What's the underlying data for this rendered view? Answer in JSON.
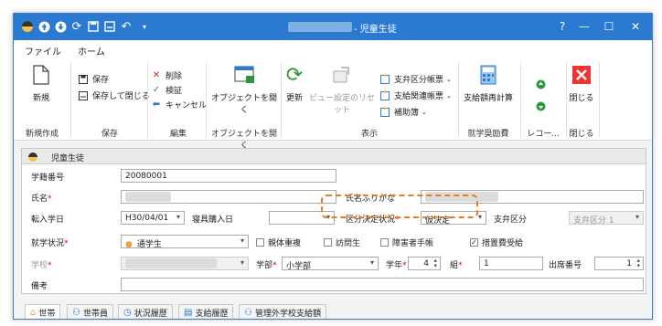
{
  "window": {
    "title": "- 児童生徒",
    "quick_icons": [
      "app-icon",
      "up-circle-icon",
      "down-circle-icon",
      "refresh-icon",
      "save-icon",
      "save-close-icon",
      "undo-icon",
      "dropdown-icon"
    ]
  },
  "menu": {
    "file": "ファイル",
    "home": "ホーム"
  },
  "ribbon": {
    "new": "新規",
    "save": "保存",
    "save_close": "保存して閉じる",
    "delete": "削除",
    "verify": "検証",
    "cancel": "キャンセル",
    "open_object": "オブジェクトを開く",
    "refresh": "更新",
    "reset_view": "ビュー設定のリセット",
    "ledger1": "支弁区分帳票",
    "ledger2": "支給関連帳票",
    "aux": "補助簿",
    "recalc": "支給額再計算",
    "close": "閉じる",
    "groups": {
      "new": "新規作成",
      "save": "保存",
      "edit": "編集",
      "open_obj": "オブジェクトを開く",
      "display": "表示",
      "school_aid": "就学奨励費",
      "record": "レコー...",
      "close": "閉じる"
    }
  },
  "panel_title": "児童生徒",
  "form": {
    "student_no_label": "学籍番号",
    "student_no": "20080001",
    "name_label": "氏名",
    "kana_label": "氏名ふりがな",
    "transfer_label": "転入学日",
    "transfer_date": "H30/04/01",
    "bedding_label": "寝具購入日",
    "decision_status_label": "区分決定状況",
    "decision_status": "仮決定",
    "shiben_label": "支弁区分",
    "shiben_value": "支弁区分 1",
    "attend_label": "就学状況",
    "attend_value": "通学生",
    "chk_dorm": "親体重複",
    "chk_visit": "訪問生",
    "chk_disab": "障害者手帳",
    "chk_measure": "措置費受給",
    "school_label": "学校",
    "dept_label": "学部",
    "dept_value": "小学部",
    "grade_label": "学年",
    "grade_value": "4",
    "class_label": "組",
    "class_value": "1",
    "seat_label": "出席番号",
    "seat_value": "1",
    "note_label": "備考"
  },
  "tabs": [
    "世帯",
    "世帯員",
    "状況履歴",
    "支給履歴",
    "管理外学校支給額"
  ]
}
